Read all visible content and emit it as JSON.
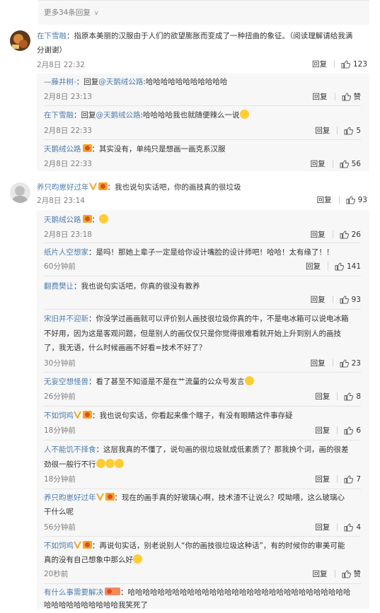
{
  "more_replies": {
    "label": "更多34条回复"
  },
  "comments": [
    {
      "user": "在下雪融",
      "text_line1": "：指原本美丽的汉服由于人们的欲望膨胀而变成了一种扭曲的象征。（阅读理解请给我满",
      "text_line2": "分谢谢）",
      "time": "2月8日 22:32",
      "reply_label": "回复",
      "likes": "123",
      "replies": [
        {
          "user": "—藤井树-",
          "text": "：回复",
          "mention": "@天鹅绒公路",
          "text2": ":哈哈哈哈哈哈哈哈哈哈哈",
          "time": "2月8日 23:13",
          "reply_label": "回复",
          "likes": "赞"
        },
        {
          "user": "在下雪融",
          "text": "：回复",
          "mention": "@天鹅绒公路",
          "text2": ":哈哈哈哈我也就随便辣么一说",
          "time": "2月8日 22:33",
          "reply_label": "回复",
          "likes": "5"
        },
        {
          "user": "天鹅绒公路",
          "text": "：其实没有，单纯只是想画一画克系汉服",
          "time": "2月8日 22:33",
          "reply_label": "回复",
          "likes": "56"
        }
      ]
    },
    {
      "user": "养只昀崽好过年",
      "text_line1": "：我也说句实话吧，你的画技真的很垃圾",
      "time": "2月8日 23:14",
      "reply_label": "回复",
      "likes": "93",
      "replies": [
        {
          "user": "天鹅绒公路",
          "text": "：",
          "time": "2月8日 23:18",
          "reply_label": "回复",
          "likes": "26"
        },
        {
          "user": "纸片人空想家",
          "text": "：是吗！那她上辈子一定是给你设计嘴脸的设计师吧！哈哈！太有缘了！！",
          "time": "60分钟前",
          "reply_label": "回复",
          "likes": "141"
        },
        {
          "user": "翻费樊让",
          "text": "：我也说句实话吧，你真的很没有教养",
          "time": "",
          "reply_label": "回复",
          "likes": "93"
        },
        {
          "user": "宋旧并不迎新",
          "text": "：你没学过画画就可以评价别人画技很垃圾你真的牛，不是电冰箱可以说电冰箱",
          "text_line2": "不好用，因为这是客观问题，但是别人的画仅仅只是你觉得很难看就开始上升到别人的画技",
          "text_line3": "了，我无语，什么时候画画不好看=技术不好了？",
          "time": "30分钟前",
          "reply_label": "回复",
          "likes": "23"
        },
        {
          "user": "无妄空想怪兽",
          "text": "：看了甚至不知道是不是在艹流量的公众号发言",
          "time": "26分钟前",
          "reply_label": "回复",
          "likes": "8"
        },
        {
          "user": "不如饲鸡",
          "text": "：我也说句实话，你看起来像个瞎子，有没有眼睛这件事存疑",
          "time": "18分钟前",
          "reply_label": "回复",
          "likes": "6"
        },
        {
          "user": "人不能饥不择食",
          "text": "：这层我真的不懂了，说句画的很垃圾就成低素质了？那我换个词，画的很差",
          "text_line2": "劲很一般行不行",
          "time": "18分钟前",
          "reply_label": "回复",
          "likes": "7"
        },
        {
          "user": "养只昀崽好过年",
          "text": "：现在的画手真的好玻璃心啊，技术渣不让说么？哎呦喂，这么玻璃心",
          "text_line2": "干什么呢",
          "time": "56分钟前",
          "reply_label": "回复",
          "likes": "4"
        },
        {
          "user": "不如饲鸡",
          "text": "：再说句实话，别老说别人“你的画技很垃圾这种话”，有的时候你的审美可能",
          "text_line2": "真的没有自己想象中那么好",
          "time": "20秒前",
          "reply_label": "回复",
          "likes": "赞"
        },
        {
          "user": "有什么事需要解决",
          "text": "：哈哈哈哈哈哈哈哈哈哈哈哈哈哈哈哈哈哈哈哈哈哈哈哈哈哈哈哈哈哈",
          "text_line2": "哈哈哈哈哈哈哈哈哈哈我笑死了"
        }
      ]
    }
  ]
}
